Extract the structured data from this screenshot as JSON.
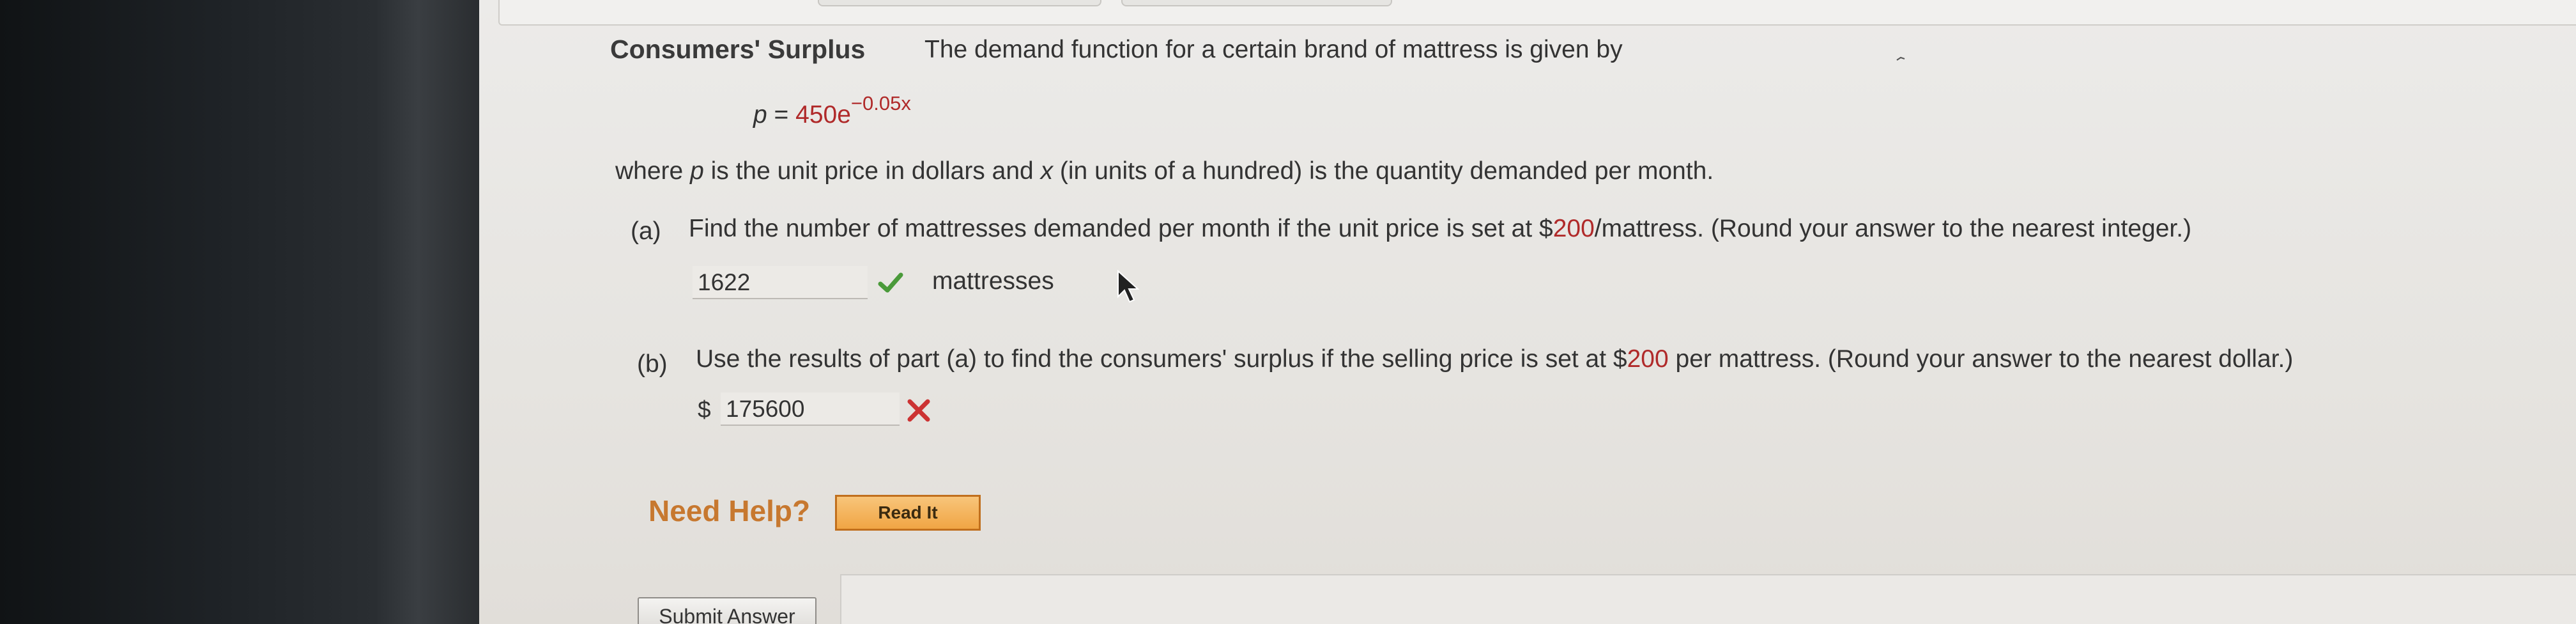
{
  "problem": {
    "title": "Consumers' Surplus",
    "intro": "The demand function for a certain brand of mattress is given by",
    "equation": {
      "var": "p",
      "equals": " = ",
      "base": "450e",
      "exponent": "−0.05x"
    },
    "description": {
      "part1": "where ",
      "p": "p",
      "part2": " is the unit price in dollars and ",
      "x": "x",
      "part3": " (in units of a hundred) is the quantity demanded per month."
    }
  },
  "part_a": {
    "label": "(a)",
    "question_before": "Find the number of mattresses demanded per month if the unit price is set at $",
    "price": "200",
    "question_after": "/mattress. (Round your answer to the nearest integer.)",
    "answer_value": "1622",
    "unit": "mattresses",
    "status": "correct"
  },
  "part_b": {
    "label": "(b)",
    "question_before": "Use the results of part (a) to find the consumers' surplus if the selling price is set at $",
    "price": "200",
    "question_after": " per mattress. (Round your answer to the nearest dollar.)",
    "currency": "$",
    "answer_value": "175600",
    "status": "incorrect"
  },
  "help": {
    "label": "Need Help?",
    "button": "Read It"
  },
  "submit": {
    "label": "Submit Answer"
  },
  "colors": {
    "accent_red": "#b02a2a",
    "correct_green": "#4a9a3a",
    "incorrect_red": "#cc3333",
    "help_orange": "#c7782f",
    "read_it_orange": "#f0a544"
  },
  "icons": [
    "check-icon",
    "x-icon",
    "cursor-icon"
  ]
}
